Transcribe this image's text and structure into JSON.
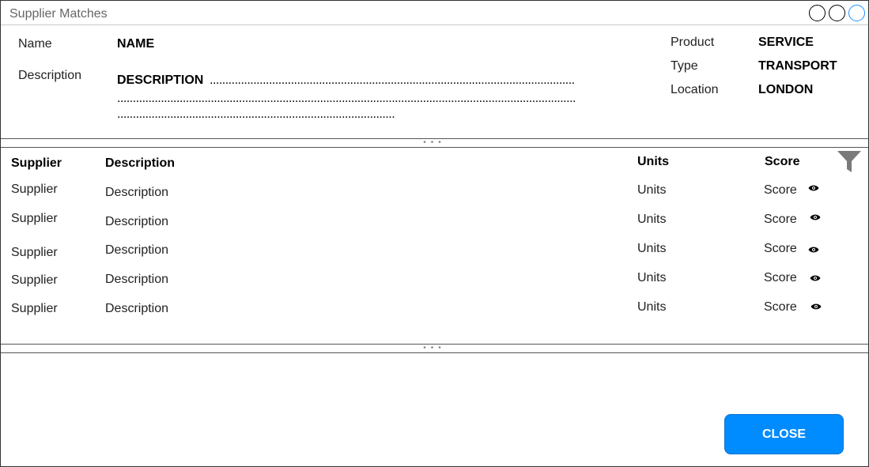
{
  "window": {
    "title": "Supplier Matches",
    "accent_color": "#1e90ff"
  },
  "details": {
    "name_label": "Name",
    "name_value": "NAME",
    "description_label": "Description",
    "description_value": "DESCRIPTION",
    "product_label": "Product",
    "product_value": "SERVICE",
    "type_label": "Type",
    "type_value": "TRANSPORT",
    "location_label": "Location",
    "location_value": "LONDON"
  },
  "table": {
    "headers": {
      "supplier": "Supplier",
      "description": "Description",
      "units": "Units",
      "score": "Score"
    },
    "rows": [
      {
        "supplier": "Supplier",
        "description": "Description",
        "units": "Units",
        "score": "Score"
      },
      {
        "supplier": "Supplier",
        "description": "Description",
        "units": "Units",
        "score": "Score"
      },
      {
        "supplier": "Supplier",
        "description": "Description",
        "units": "Units",
        "score": "Score"
      },
      {
        "supplier": "Supplier",
        "description": "Description",
        "units": "Units",
        "score": "Score"
      },
      {
        "supplier": "Supplier",
        "description": "Description",
        "units": "Units",
        "score": "Score"
      }
    ],
    "row_icon": "eye-icon",
    "filter_icon": "filter-icon"
  },
  "footer": {
    "close_label": "CLOSE",
    "close_color": "#008cff"
  }
}
